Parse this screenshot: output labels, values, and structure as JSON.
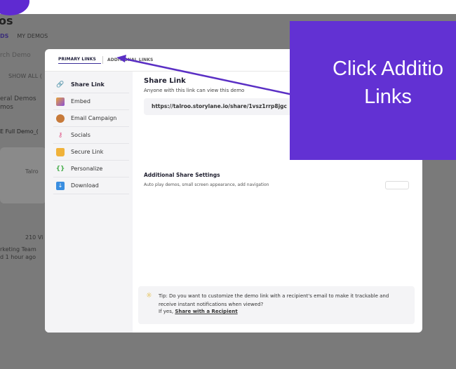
{
  "background": {
    "title": "os",
    "tabs": [
      "DS",
      "MY DEMOS"
    ],
    "search_placeholder": "rch Demo",
    "show_all": "SHOW ALL (",
    "demo_list": [
      "eral Demos",
      "mos"
    ],
    "demo_card_title": "E Full Demo_(",
    "card_brand": "Talro",
    "views": "210 Vi",
    "team": [
      "rketing Team",
      "d 1 hour ago"
    ]
  },
  "modal": {
    "tabs": [
      {
        "label": "PRIMARY LINKS",
        "active": true
      },
      {
        "label": "ADDITIONAL LINKS",
        "active": false
      }
    ],
    "sidebar": [
      {
        "label": "Share Link",
        "icon": "link-icon",
        "active": true
      },
      {
        "label": "Embed",
        "icon": "embed-icon",
        "active": false
      },
      {
        "label": "Email Campaign",
        "icon": "email-campaign-icon",
        "active": false
      },
      {
        "label": "Socials",
        "icon": "share-icon",
        "active": false
      },
      {
        "label": "Secure Link",
        "icon": "lock-icon",
        "active": false
      },
      {
        "label": "Personalize",
        "icon": "personalize-icon",
        "active": false
      },
      {
        "label": "Download",
        "icon": "download-icon",
        "active": false
      }
    ],
    "share_link": {
      "title": "Share Link",
      "subtitle": "Anyone with this link can view this demo",
      "url": "https://talroo.storylane.io/share/1vsz1rrp8jgc"
    },
    "additional_settings": {
      "title": "Additional Share Settings",
      "subtitle": "Auto play demos, small screen appearance, add navigation"
    },
    "tip": {
      "text": "Tip: Do you want to customize the demo link with a recipient's email to make it trackable and receive instant notifications when viewed?",
      "link_prefix": "If yes, ",
      "link_label": "Share with a Recipient"
    }
  },
  "callout": {
    "lines": [
      "Click Additio",
      "Links"
    ],
    "color": "#6231d3"
  }
}
